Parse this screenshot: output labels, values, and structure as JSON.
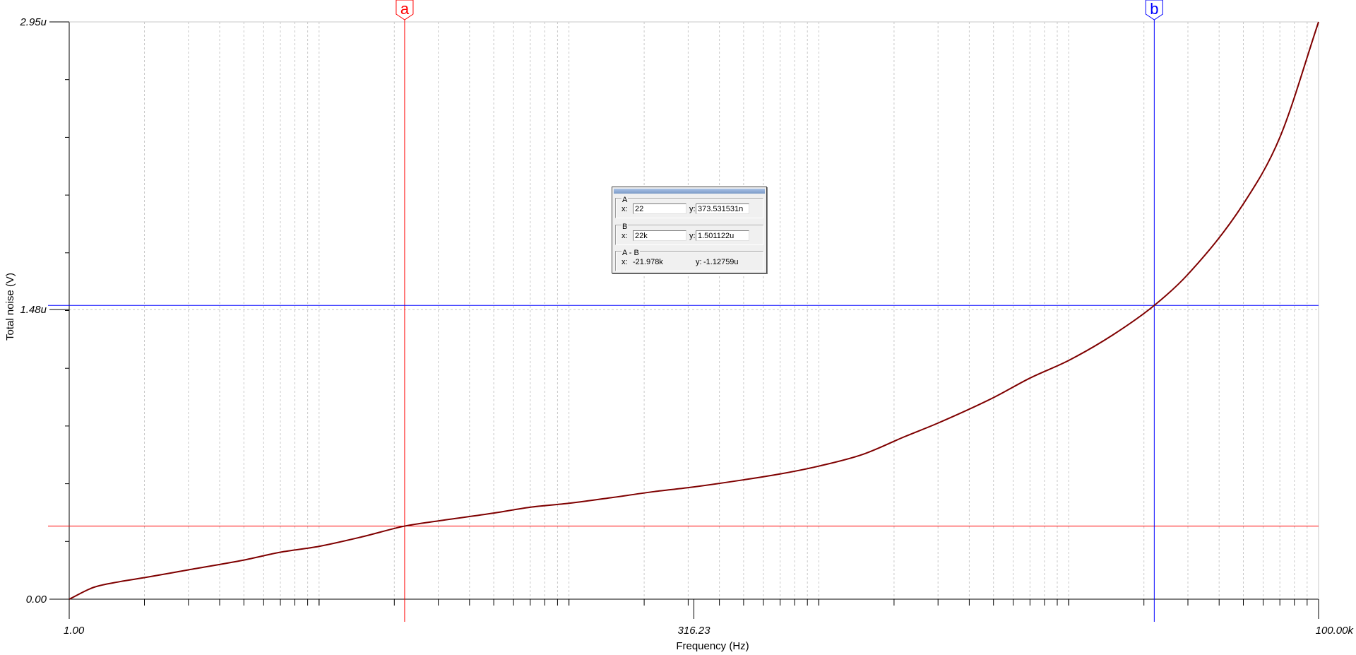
{
  "chart_data": {
    "type": "line",
    "title": "",
    "xlabel": "Frequency (Hz)",
    "ylabel": "Total noise (V)",
    "x_scale": "log",
    "xlim": [
      1,
      100000
    ],
    "ylim": [
      0,
      2.95
    ],
    "y_unit": "u",
    "x_tick_labels": [
      "1.00",
      "316.23",
      "100.00k"
    ],
    "x_tick_values": [
      1,
      316.23,
      100000
    ],
    "y_tick_labels": [
      "0.00",
      "1.48u",
      "2.95u"
    ],
    "y_tick_values": [
      0,
      1.48,
      2.95
    ],
    "grid": true,
    "line_color": "#7f0000",
    "series": [
      {
        "x": [
          1,
          1.25,
          1.6,
          2,
          3,
          5,
          7,
          10,
          15,
          22,
          30,
          50,
          70,
          100,
          150,
          220,
          300,
          500,
          700,
          1000,
          1500,
          2200,
          3000,
          5000,
          7000,
          10000,
          15000,
          22000,
          30000,
          50000,
          70000,
          100000
        ],
        "y": [
          0.0,
          0.06,
          0.09,
          0.11,
          0.15,
          0.2,
          0.24,
          0.27,
          0.32,
          0.3735,
          0.4,
          0.44,
          0.47,
          0.49,
          0.52,
          0.55,
          0.57,
          0.61,
          0.64,
          0.68,
          0.74,
          0.83,
          0.9,
          1.03,
          1.13,
          1.22,
          1.35,
          1.5011,
          1.66,
          2.02,
          2.36,
          2.95
        ]
      }
    ],
    "cursors": {
      "a": {
        "label": "a",
        "x": 22,
        "y": 0.3735,
        "color": "#ff0000"
      },
      "b": {
        "label": "b",
        "x": 22000,
        "y": 1.5011,
        "color": "#0000ff"
      }
    }
  },
  "cursor_panel": {
    "A": {
      "title": "A",
      "x_label": "x:",
      "x_value": "22",
      "y_label": "y:",
      "y_value": "373.531531n"
    },
    "B": {
      "title": "B",
      "x_label": "x:",
      "x_value": "22k",
      "y_label": "y:",
      "y_value": "1.501122u"
    },
    "diff": {
      "title": "A - B",
      "x_label": "x:",
      "x_value": "-21.978k",
      "y_label": "y:",
      "y_value": "-1.12759u"
    }
  }
}
